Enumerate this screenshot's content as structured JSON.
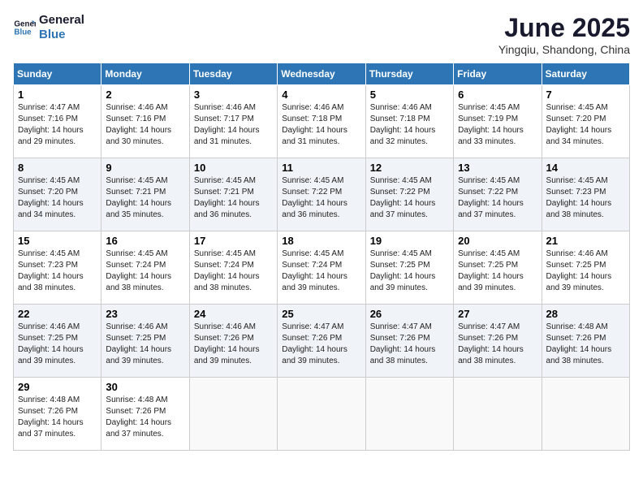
{
  "logo": {
    "line1": "General",
    "line2": "Blue"
  },
  "header": {
    "month": "June 2025",
    "location": "Yingqiu, Shandong, China"
  },
  "weekdays": [
    "Sunday",
    "Monday",
    "Tuesday",
    "Wednesday",
    "Thursday",
    "Friday",
    "Saturday"
  ],
  "weeks": [
    [
      {
        "day": "1",
        "sunrise": "4:47 AM",
        "sunset": "7:16 PM",
        "daylight": "14 hours and 29 minutes."
      },
      {
        "day": "2",
        "sunrise": "4:46 AM",
        "sunset": "7:16 PM",
        "daylight": "14 hours and 30 minutes."
      },
      {
        "day": "3",
        "sunrise": "4:46 AM",
        "sunset": "7:17 PM",
        "daylight": "14 hours and 31 minutes."
      },
      {
        "day": "4",
        "sunrise": "4:46 AM",
        "sunset": "7:18 PM",
        "daylight": "14 hours and 31 minutes."
      },
      {
        "day": "5",
        "sunrise": "4:46 AM",
        "sunset": "7:18 PM",
        "daylight": "14 hours and 32 minutes."
      },
      {
        "day": "6",
        "sunrise": "4:45 AM",
        "sunset": "7:19 PM",
        "daylight": "14 hours and 33 minutes."
      },
      {
        "day": "7",
        "sunrise": "4:45 AM",
        "sunset": "7:20 PM",
        "daylight": "14 hours and 34 minutes."
      }
    ],
    [
      {
        "day": "8",
        "sunrise": "4:45 AM",
        "sunset": "7:20 PM",
        "daylight": "14 hours and 34 minutes."
      },
      {
        "day": "9",
        "sunrise": "4:45 AM",
        "sunset": "7:21 PM",
        "daylight": "14 hours and 35 minutes."
      },
      {
        "day": "10",
        "sunrise": "4:45 AM",
        "sunset": "7:21 PM",
        "daylight": "14 hours and 36 minutes."
      },
      {
        "day": "11",
        "sunrise": "4:45 AM",
        "sunset": "7:22 PM",
        "daylight": "14 hours and 36 minutes."
      },
      {
        "day": "12",
        "sunrise": "4:45 AM",
        "sunset": "7:22 PM",
        "daylight": "14 hours and 37 minutes."
      },
      {
        "day": "13",
        "sunrise": "4:45 AM",
        "sunset": "7:22 PM",
        "daylight": "14 hours and 37 minutes."
      },
      {
        "day": "14",
        "sunrise": "4:45 AM",
        "sunset": "7:23 PM",
        "daylight": "14 hours and 38 minutes."
      }
    ],
    [
      {
        "day": "15",
        "sunrise": "4:45 AM",
        "sunset": "7:23 PM",
        "daylight": "14 hours and 38 minutes."
      },
      {
        "day": "16",
        "sunrise": "4:45 AM",
        "sunset": "7:24 PM",
        "daylight": "14 hours and 38 minutes."
      },
      {
        "day": "17",
        "sunrise": "4:45 AM",
        "sunset": "7:24 PM",
        "daylight": "14 hours and 38 minutes."
      },
      {
        "day": "18",
        "sunrise": "4:45 AM",
        "sunset": "7:24 PM",
        "daylight": "14 hours and 39 minutes."
      },
      {
        "day": "19",
        "sunrise": "4:45 AM",
        "sunset": "7:25 PM",
        "daylight": "14 hours and 39 minutes."
      },
      {
        "day": "20",
        "sunrise": "4:45 AM",
        "sunset": "7:25 PM",
        "daylight": "14 hours and 39 minutes."
      },
      {
        "day": "21",
        "sunrise": "4:46 AM",
        "sunset": "7:25 PM",
        "daylight": "14 hours and 39 minutes."
      }
    ],
    [
      {
        "day": "22",
        "sunrise": "4:46 AM",
        "sunset": "7:25 PM",
        "daylight": "14 hours and 39 minutes."
      },
      {
        "day": "23",
        "sunrise": "4:46 AM",
        "sunset": "7:25 PM",
        "daylight": "14 hours and 39 minutes."
      },
      {
        "day": "24",
        "sunrise": "4:46 AM",
        "sunset": "7:26 PM",
        "daylight": "14 hours and 39 minutes."
      },
      {
        "day": "25",
        "sunrise": "4:47 AM",
        "sunset": "7:26 PM",
        "daylight": "14 hours and 39 minutes."
      },
      {
        "day": "26",
        "sunrise": "4:47 AM",
        "sunset": "7:26 PM",
        "daylight": "14 hours and 38 minutes."
      },
      {
        "day": "27",
        "sunrise": "4:47 AM",
        "sunset": "7:26 PM",
        "daylight": "14 hours and 38 minutes."
      },
      {
        "day": "28",
        "sunrise": "4:48 AM",
        "sunset": "7:26 PM",
        "daylight": "14 hours and 38 minutes."
      }
    ],
    [
      {
        "day": "29",
        "sunrise": "4:48 AM",
        "sunset": "7:26 PM",
        "daylight": "14 hours and 37 minutes."
      },
      {
        "day": "30",
        "sunrise": "4:48 AM",
        "sunset": "7:26 PM",
        "daylight": "14 hours and 37 minutes."
      },
      null,
      null,
      null,
      null,
      null
    ]
  ]
}
